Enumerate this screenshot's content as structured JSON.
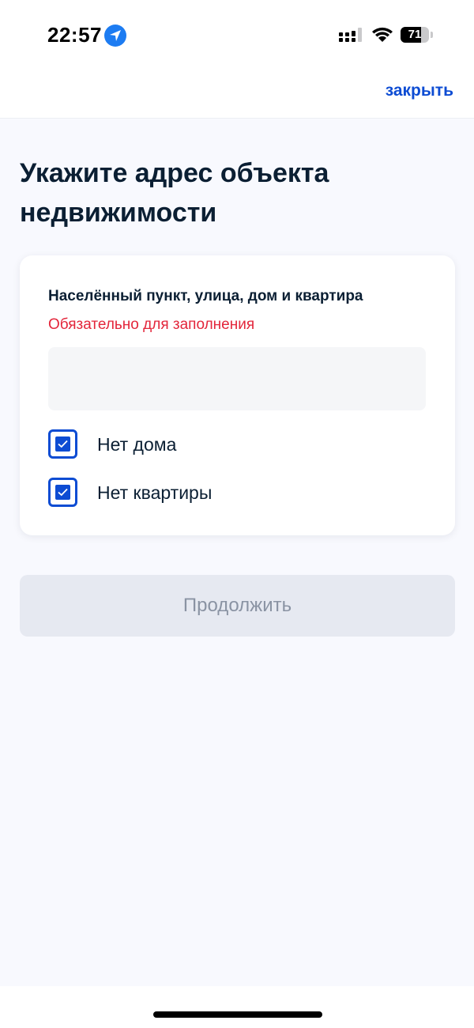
{
  "status_bar": {
    "time": "22:57",
    "battery_level": "71",
    "icons": [
      "location-arrow-icon",
      "cellular-signal-icon",
      "wifi-icon",
      "battery-icon"
    ]
  },
  "header": {
    "close_label": "закрыть"
  },
  "page": {
    "title": "Укажите адрес объекта недвижимости"
  },
  "address_form": {
    "field_label": "Населённый пункт, улица, дом и квартира",
    "error_text": "Обязательно для заполнения",
    "input_value": "",
    "checkboxes": [
      {
        "label": "Нет дома",
        "checked": true
      },
      {
        "label": "Нет квартиры",
        "checked": true
      }
    ]
  },
  "actions": {
    "continue_label": "Продолжить",
    "continue_enabled": false
  },
  "colors": {
    "accent": "#0d4cd3",
    "error": "#e3263b",
    "text": "#0b1f33",
    "background": "#f8f9fe",
    "disabled_button": "#e6e9f1"
  }
}
